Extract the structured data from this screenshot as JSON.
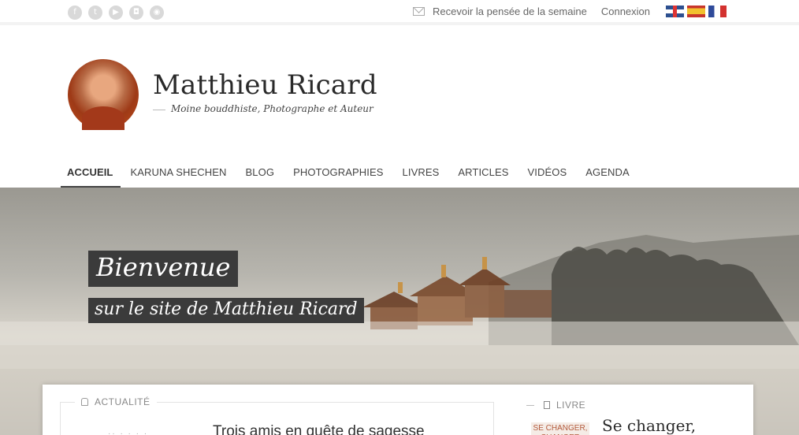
{
  "topbar": {
    "social_icons": [
      {
        "name": "facebook-icon",
        "glyph": "f"
      },
      {
        "name": "twitter-icon",
        "glyph": "t"
      },
      {
        "name": "youtube-icon",
        "glyph": "▶"
      },
      {
        "name": "instagram-icon",
        "glyph": "◘"
      },
      {
        "name": "rss-icon",
        "glyph": "◉"
      }
    ],
    "newsletter_label": "Recevoir la pensée de la semaine",
    "login_label": "Connexion",
    "flags": [
      "english-flag-icon",
      "spanish-flag-icon",
      "french-flag-icon"
    ]
  },
  "header": {
    "site_title": "Matthieu Ricard",
    "tagline": "Moine bouddhiste, Photographe et Auteur"
  },
  "nav": {
    "items": [
      {
        "label": "ACCUEIL",
        "active": true
      },
      {
        "label": "KARUNA SHECHEN",
        "active": false
      },
      {
        "label": "BLOG",
        "active": false
      },
      {
        "label": "PHOTOGRAPHIES",
        "active": false
      },
      {
        "label": "LIVRES",
        "active": false
      },
      {
        "label": "ARTICLES",
        "active": false
      },
      {
        "label": "VIDÉOS",
        "active": false
      },
      {
        "label": "AGENDA",
        "active": false
      }
    ]
  },
  "hero": {
    "welcome": "Bienvenue",
    "subtitle": "sur le site de Matthieu Ricard"
  },
  "content": {
    "news_label": "ACTUALITÉ",
    "news_title": "Trois amis en quête de sagesse",
    "book_label": "LIVRE",
    "book_thumb_text": "SE CHANGER, CHANGER",
    "book_title": "Se changer,"
  },
  "colors": {
    "banner_bg": "#3b3b3b",
    "book_accent": "#b35a3c"
  }
}
